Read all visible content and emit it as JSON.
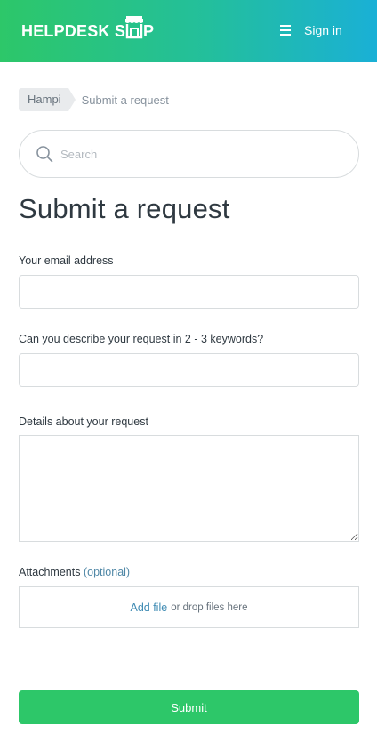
{
  "header": {
    "logo_part1": "HELPDESK S",
    "logo_part2": "P",
    "signin_label": "Sign in"
  },
  "breadcrumb": {
    "home": "Hampi",
    "current": "Submit a request"
  },
  "search": {
    "placeholder": "Search"
  },
  "page": {
    "title": "Submit a request"
  },
  "form": {
    "email_label": "Your email address",
    "email_value": "",
    "keywords_label": "Can you describe your request in 2 - 3 keywords?",
    "keywords_value": "",
    "details_label": "Details about your request",
    "details_value": "",
    "attachments_label": "Attachments",
    "attachments_optional": "(optional)",
    "add_file": "Add file",
    "drop_text": "or drop files here",
    "submit_label": "Submit"
  },
  "colors": {
    "header_gradient_start": "#2dc769",
    "header_gradient_end": "#1ab0d6",
    "submit_button": "#2dc769",
    "link": "#3f8bb3"
  }
}
